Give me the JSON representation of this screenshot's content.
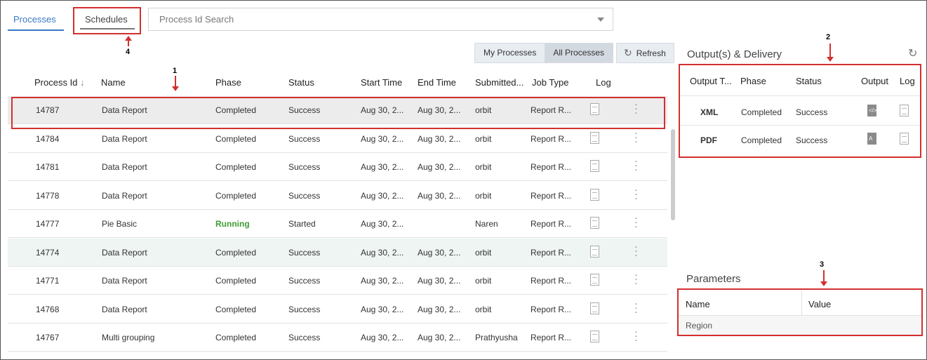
{
  "tabs": {
    "processes": "Processes",
    "schedules": "Schedules"
  },
  "search": {
    "placeholder": "Process Id Search"
  },
  "filters": {
    "my": "My Processes",
    "all": "All Processes",
    "refresh": "Refresh"
  },
  "annotations": [
    "1",
    "2",
    "3",
    "4"
  ],
  "colors": {
    "accent": "#3a7ac7",
    "running": "#3f9c35",
    "annotation": "#d32f2f"
  },
  "table": {
    "headers": [
      "Process Id",
      "Name",
      "Phase",
      "Status",
      "Start Time",
      "End Time",
      "Submitted...",
      "Job Type",
      "Log"
    ],
    "sort_icon": "sort-down-arrow",
    "rows": [
      {
        "id": "14787",
        "name": "Data Report",
        "phase": "Completed",
        "status": "Success",
        "start": "Aug 30, 2...",
        "end": "Aug 30, 2...",
        "submitted": "orbit",
        "job": "Report R..."
      },
      {
        "id": "14784",
        "name": "Data Report",
        "phase": "Completed",
        "status": "Success",
        "start": "Aug 30, 2...",
        "end": "Aug 30, 2...",
        "submitted": "orbit",
        "job": "Report R..."
      },
      {
        "id": "14781",
        "name": "Data Report",
        "phase": "Completed",
        "status": "Success",
        "start": "Aug 30, 2...",
        "end": "Aug 30, 2...",
        "submitted": "orbit",
        "job": "Report R..."
      },
      {
        "id": "14778",
        "name": "Data Report",
        "phase": "Completed",
        "status": "Success",
        "start": "Aug 30, 2...",
        "end": "Aug 30, 2...",
        "submitted": "orbit",
        "job": "Report R..."
      },
      {
        "id": "14777",
        "name": "Pie Basic",
        "phase": "Running",
        "status": "Started",
        "start": "Aug 30, 2...",
        "end": "",
        "submitted": "Naren",
        "job": "Report R..."
      },
      {
        "id": "14774",
        "name": "Data Report",
        "phase": "Completed",
        "status": "Success",
        "start": "Aug 30, 2...",
        "end": "Aug 30, 2...",
        "submitted": "orbit",
        "job": "Report R..."
      },
      {
        "id": "14771",
        "name": "Data Report",
        "phase": "Completed",
        "status": "Success",
        "start": "Aug 30, 2...",
        "end": "Aug 30, 2...",
        "submitted": "orbit",
        "job": "Report R..."
      },
      {
        "id": "14768",
        "name": "Data Report",
        "phase": "Completed",
        "status": "Success",
        "start": "Aug 30, 2...",
        "end": "Aug 30, 2...",
        "submitted": "orbit",
        "job": "Report R..."
      },
      {
        "id": "14767",
        "name": "Multi grouping",
        "phase": "Completed",
        "status": "Success",
        "start": "Aug 30, 2...",
        "end": "Aug 30, 2...",
        "submitted": "Prathyusha",
        "job": "Report R..."
      }
    ]
  },
  "outputs": {
    "title": "Output(s) & Delivery",
    "headers": [
      "Output T...",
      "Phase",
      "Status",
      "Output",
      "Log"
    ],
    "rows": [
      {
        "type": "XML",
        "phase": "Completed",
        "status": "Success",
        "icon": "xml-file-icon"
      },
      {
        "type": "PDF",
        "phase": "Completed",
        "status": "Success",
        "icon": "pdf-file-icon"
      }
    ]
  },
  "parameters": {
    "title": "Parameters",
    "headers": [
      "Name",
      "Value"
    ],
    "rows": [
      {
        "name": "Region",
        "value": ""
      }
    ]
  }
}
